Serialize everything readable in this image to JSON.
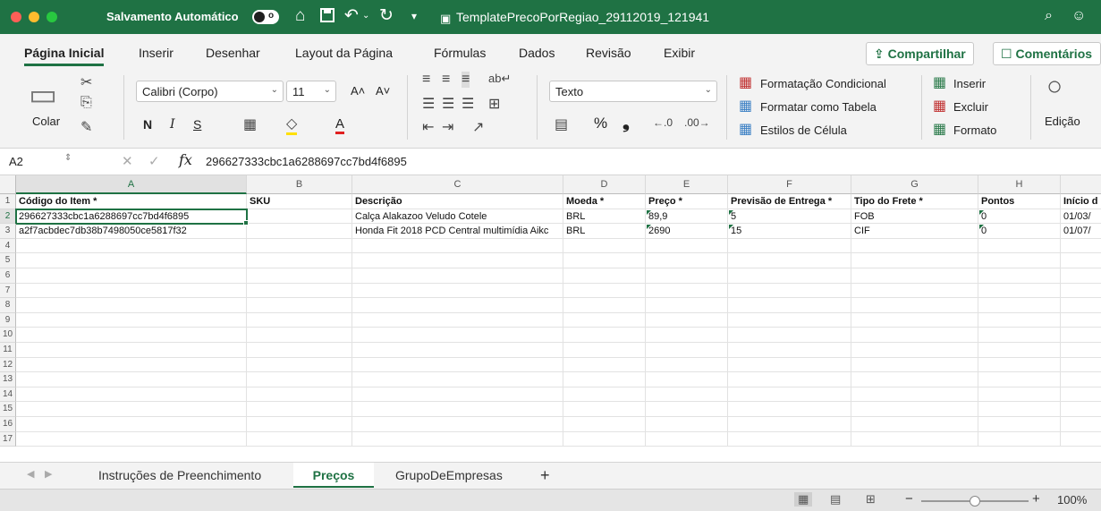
{
  "titlebar": {
    "autosave_label": "Salvamento Automático",
    "toggle_state": "o",
    "filename": "TemplatePrecoPorRegiao_29112019_121941",
    "colors": {
      "bar": "#1f7244",
      "close": "#ff5f57",
      "min": "#febc2e",
      "max": "#28c840"
    }
  },
  "ribbon_tabs": [
    "Página Inicial",
    "Inserir",
    "Desenhar",
    "Layout da Página",
    "Fórmulas",
    "Dados",
    "Revisão",
    "Exibir"
  ],
  "share_button": "Compartilhar",
  "comments_button": "Comentários",
  "ribbon": {
    "paste_label": "Colar",
    "font_name": "Calibri (Corpo)",
    "font_size": "11",
    "grow_font": "A˄",
    "shrink_font": "A˅",
    "bold": "N",
    "italic": "I",
    "underline": "S",
    "font_color": "A",
    "number_format": "Texto",
    "percent": "%",
    "comma": "❟",
    "cond_format": "Formatação Condicional",
    "format_table": "Formatar como Tabela",
    "cell_styles": "Estilos de Célula",
    "insert": "Inserir",
    "delete": "Excluir",
    "format": "Formato",
    "editing": "Edição"
  },
  "formula_bar": {
    "name_box": "A2",
    "fx": "fx",
    "formula": "296627333cbc1a6288697cc7bd4f6895"
  },
  "columns": [
    "A",
    "B",
    "C",
    "D",
    "E",
    "F",
    "G",
    "H",
    ""
  ],
  "rows": [
    "1",
    "2",
    "3",
    "4",
    "5",
    "6",
    "7",
    "8",
    "9",
    "10",
    "11",
    "12",
    "13",
    "14",
    "15",
    "16",
    "17"
  ],
  "cells": {
    "header": [
      "Código do Item *",
      "SKU",
      "Descrição",
      "Moeda *",
      "Preço *",
      "Previsão de Entrega *",
      "Tipo do Frete *",
      "Pontos",
      "Início d"
    ],
    "row2": [
      "296627333cbc1a6288697cc7bd4f6895",
      "",
      "Calça Alakazoo Veludo Cotele",
      "BRL",
      "89,9",
      "5",
      "FOB",
      "0",
      "01/03/"
    ],
    "row3": [
      "a2f7acbdec7db38b7498050ce5817f32",
      "",
      "Honda Fit 2018 PCD Central multimídia Aikc",
      "BRL",
      "2690",
      "15",
      "CIF",
      "0",
      "01/07/"
    ]
  },
  "sheet_tabs": [
    "Instruções de Preenchimento",
    "Preços",
    "GrupoDeEmpresas"
  ],
  "active_sheet": "Preços",
  "add_sheet": "+",
  "status": {
    "zoom": "100%",
    "zoom_out": "−",
    "zoom_in": "+",
    "zoom_level": 0.5
  }
}
